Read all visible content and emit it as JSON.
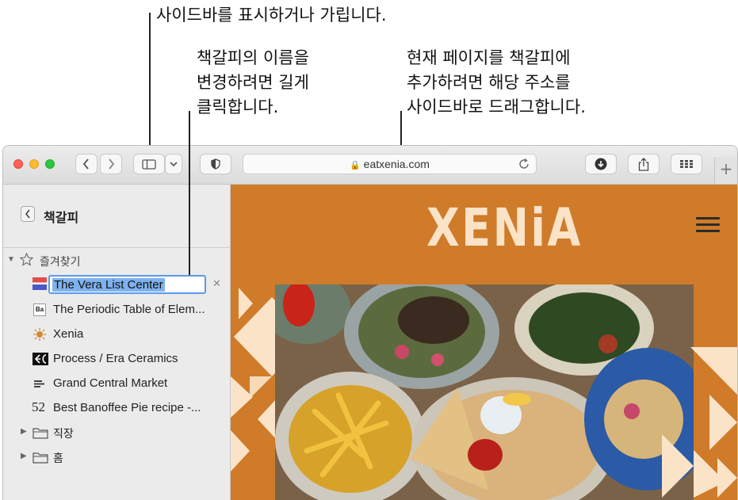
{
  "callouts": {
    "sidebar_toggle": "사이드바를 표시하거나 가립니다.",
    "rename_line1": "책갈피의 이름을",
    "rename_line2": "변경하려면 길게",
    "rename_line3": "클릭합니다.",
    "add_line1": "현재 페이지를 책갈피에",
    "add_line2": "추가하려면 해당 주소를",
    "add_line3": "사이드바로 드래그합니다."
  },
  "toolbar": {
    "url": "eatxenia.com",
    "new_tab": "+"
  },
  "sidebar": {
    "title": "책갈피",
    "favorites_label": "즐겨찾기",
    "editing_value": "The Vera List Center",
    "bookmarks": [
      {
        "label": "The Periodic Table of Elem...",
        "icon": "ba-favicon",
        "badge": "Ba"
      },
      {
        "label": "Xenia",
        "icon": "xenia-sun-favicon"
      },
      {
        "label": "Process / Era Ceramics",
        "icon": "era-ceramics-favicon"
      },
      {
        "label": "Grand Central Market",
        "icon": "grand-central-favicon"
      },
      {
        "label": "Best Banoffee Pie recipe -...",
        "icon": "number-52-favicon",
        "badge": "52"
      }
    ],
    "folders": [
      {
        "label": "직장"
      },
      {
        "label": "홈"
      }
    ]
  },
  "page": {
    "logo": "XENiA"
  },
  "colors": {
    "accent_orange": "#cf7b29",
    "logo_cream": "#fbe3c8",
    "selection_blue": "#7fb1ec"
  }
}
